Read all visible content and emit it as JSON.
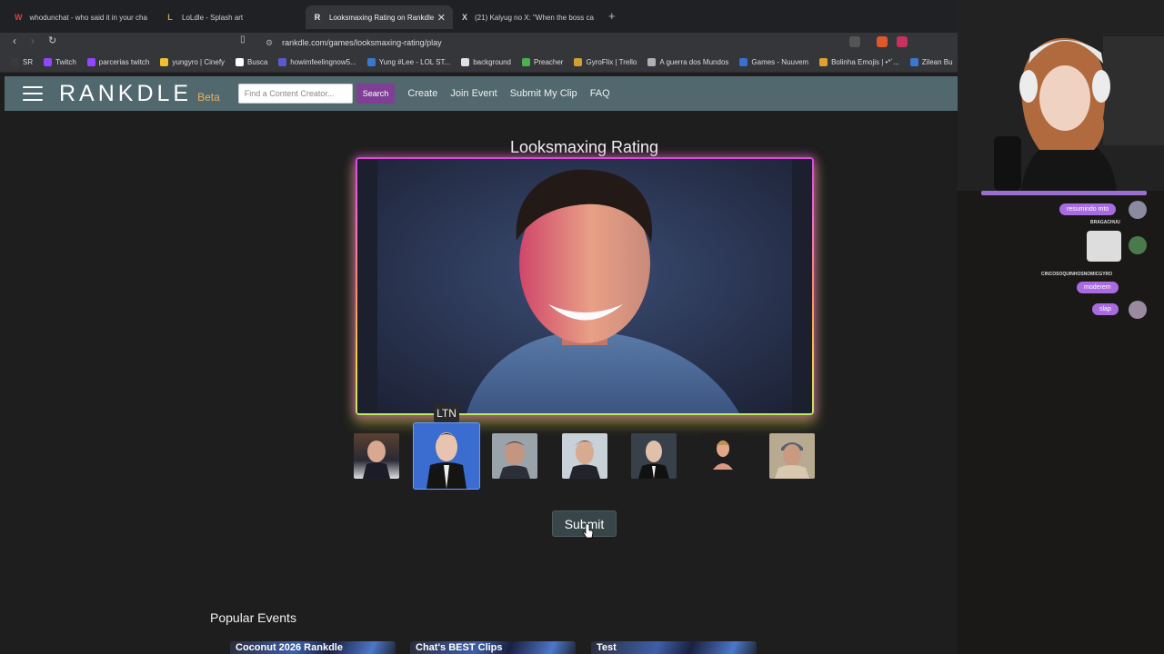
{
  "browser": {
    "tabs": [
      {
        "title": "whodunchat - who said it in your cha",
        "favicon": "W",
        "favicon_color": "#e23c3c"
      },
      {
        "title": "LoLdle - Splash art",
        "favicon": "L",
        "favicon_color": "#c8a447"
      },
      {
        "title": "Looksmaxing Rating on Rankdle",
        "favicon": "R",
        "favicon_color": "#dddddd",
        "active": true
      },
      {
        "title": "(21) Kalyug no X: \"When the boss ca",
        "favicon": "X",
        "favicon_color": "#ffffff"
      }
    ],
    "url": "rankdle.com/games/looksmaxing-rating/play",
    "bookmarks": [
      {
        "label": "SR",
        "color": "#3a3a3a"
      },
      {
        "label": "Twitch",
        "color": "#9146ff"
      },
      {
        "label": "parcerias twitch",
        "color": "#9146ff"
      },
      {
        "label": "yungyro | Cinefy",
        "color": "#f0c030"
      },
      {
        "label": "Busca",
        "color": "#ffffff"
      },
      {
        "label": "howimfeelingnow5...",
        "color": "#5a5ad0"
      },
      {
        "label": "Yung #Lee - LOL ST...",
        "color": "#3a78d0"
      },
      {
        "label": "background",
        "color": "#e0e0e0"
      },
      {
        "label": "Preacher",
        "color": "#4caf50"
      },
      {
        "label": "GyroFlix | Trello",
        "color": "#d0a030"
      },
      {
        "label": "A guerra dos Mundos",
        "color": "#b0b0b0"
      },
      {
        "label": "Games - Nuuvem",
        "color": "#3a70d0"
      },
      {
        "label": "Bolinha Emojis | •*´...",
        "color": "#e0a030"
      },
      {
        "label": "Zilean Bu",
        "color": "#3a78d0"
      }
    ]
  },
  "site": {
    "logo": "RANKDLE",
    "beta": "Beta",
    "search": {
      "placeholder": "Find a Content Creator...",
      "button": "Search"
    },
    "nav": [
      "Create",
      "Join Event",
      "Submit My Clip",
      "FAQ"
    ],
    "game_title": "Looksmaxing Rating",
    "selected_label": "LTN",
    "thumbnails": [
      {
        "name": "thumb-1",
        "selected": false
      },
      {
        "name": "thumb-2",
        "selected": true
      },
      {
        "name": "thumb-3",
        "selected": false
      },
      {
        "name": "thumb-4",
        "selected": false
      },
      {
        "name": "thumb-5",
        "selected": false
      },
      {
        "name": "thumb-6",
        "selected": false
      },
      {
        "name": "thumb-7",
        "selected": false
      }
    ],
    "submit": "Submit",
    "popular_title": "Popular Events",
    "events": [
      "Coconut 2026 Rankdle",
      "Chat's BEST Clips",
      "Test"
    ]
  },
  "stream": {
    "messages": [
      {
        "text": "resumindo mto",
        "name": ""
      },
      {
        "text": "",
        "name": "BRAGACHUU"
      },
      {
        "text": "moderem",
        "name": "CINCOSOQUINHOSNOMICGYRO"
      },
      {
        "text": "slap",
        "name": ""
      }
    ]
  },
  "colors": {
    "accent_nav": "#51686f",
    "search_button": "#7e3f94",
    "frame_glow_top": "#d84ad8",
    "frame_glow_bottom": "#f0d040",
    "chat_bubble": "#a86ce0"
  }
}
